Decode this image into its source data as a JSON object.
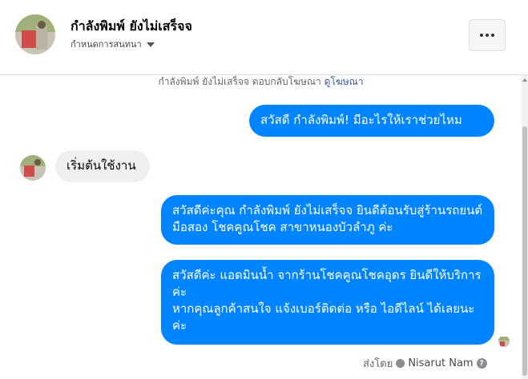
{
  "header": {
    "title": "กำลังพิมพ์ ยังไม่เสร็จจ",
    "subtitle": "กำหนดการสนทนา",
    "more_icon": "more-horizontal-icon"
  },
  "thread": {
    "notice_text": "กำลังพิมพ์ ยังไม่เสร็จจ ตอบกลับโฆษณา",
    "notice_link": "ดูโฆษณา",
    "messages": [
      {
        "side": "out",
        "text": "สวัสดี กำลังพิมพ์! มีอะไรให้เราช่วยไหม"
      },
      {
        "side": "in",
        "text": "เริ่มต้นใช้งาน"
      },
      {
        "side": "out",
        "text": "สวัสดีค่ะคุณ กำลังพิมพ์ ยังไม่เสร็จจ ยินดีต้อนรับสู่ร้านรถยนต์มือสอง โชคคูณโชค สาขาหนองบัวลำภู ค่ะ"
      },
      {
        "side": "out",
        "text": "สวัสดีค่ะ แอดมินน้ำ จากร้านโชคคูณโชคอุดร ยินดีให้บริการค่ะ\nหากคุณลูกค้าสนใจ แจ้งเบอร์ติดต่อ หรือ ไอดีไลน์ ได้เลยนะค่ะ"
      }
    ],
    "sent_by_label": "ส่งโดย",
    "sent_by_name": "Nisarut Nam",
    "help_icon": "?"
  }
}
